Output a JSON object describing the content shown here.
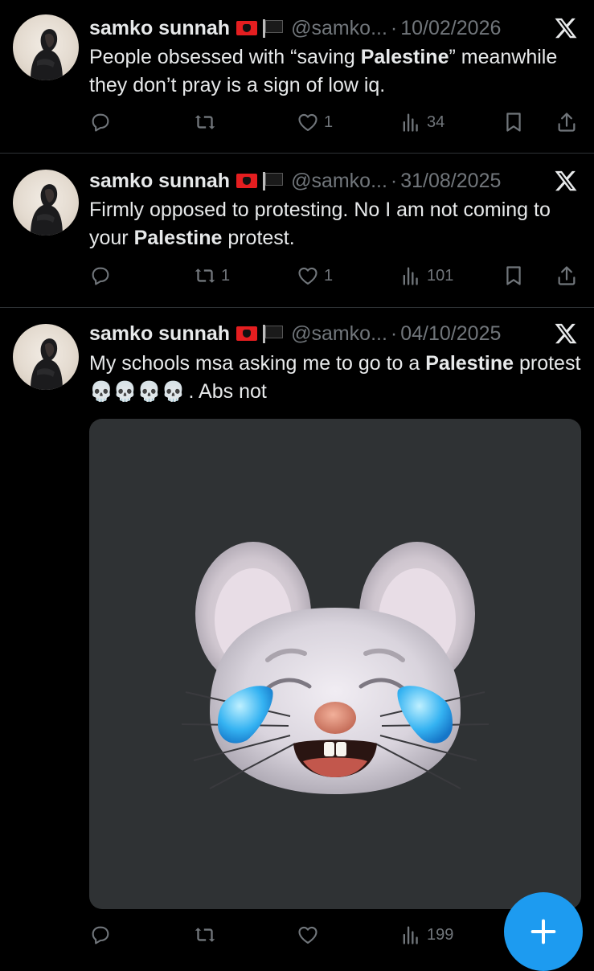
{
  "tweets": [
    {
      "name": "samko sunnah",
      "handle": "@samko...",
      "separator": "·",
      "date": "10/02/2026",
      "text_parts": [
        "People obsessed with “saving ",
        "Palestine",
        "” meanwhile they don’t pray is a sign of low iq."
      ],
      "replies": "",
      "retweets": "",
      "likes": "1",
      "views": "34"
    },
    {
      "name": "samko sunnah",
      "handle": "@samko...",
      "separator": "·",
      "date": "31/08/2025",
      "text_parts": [
        "Firmly opposed to protesting. No I am not coming to your ",
        "Palestine",
        " protest."
      ],
      "replies": "",
      "retweets": "1",
      "likes": "1",
      "views": "101"
    },
    {
      "name": "samko sunnah",
      "handle": "@samko...",
      "separator": "·",
      "date": "04/10/2025",
      "text_parts": [
        "My schools msa asking me to go to a ",
        "Palestine",
        " protest",
        "💀💀💀💀",
        ". Abs not"
      ],
      "replies": "",
      "retweets": "",
      "likes": "",
      "views": "199",
      "media": "laughing-crying-mouse-memoji"
    }
  ],
  "colors": {
    "background": "#000000",
    "text": "#e7e9ea",
    "muted": "#71767b",
    "divider": "#2f3336",
    "accent": "#1d9bf0"
  },
  "fab": {
    "icon": "plus-icon"
  }
}
